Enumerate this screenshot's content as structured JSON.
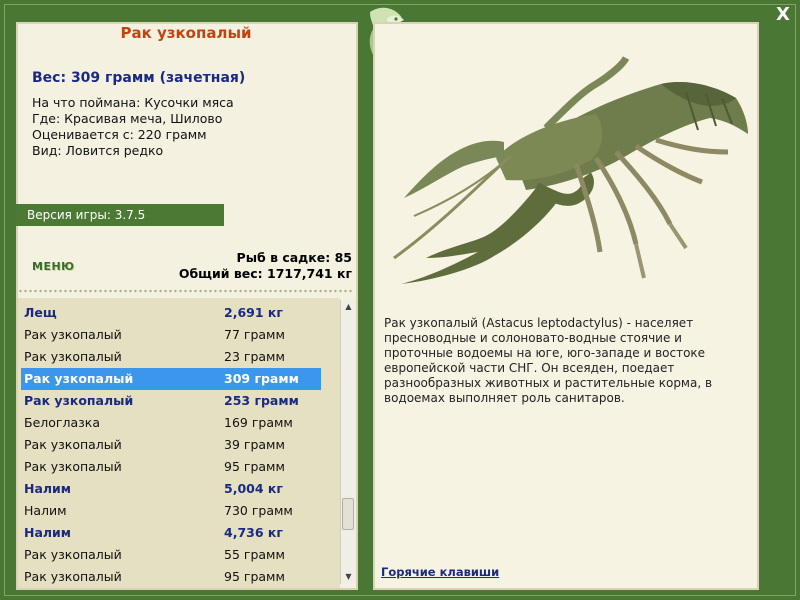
{
  "window": {
    "close_label": "X"
  },
  "fish": {
    "title": "Рак узкопалый",
    "weight": "Вес: 309 грамм (зачетная)",
    "caught_on": "На что поймана: Кусочки мяса",
    "location": "Где: Красивая меча, Шилово",
    "evaluated_from": "Оценивается с: 220 грамм",
    "kind": "Вид: Ловится редко"
  },
  "version": "Версия игры: 3.7.5",
  "menu_label": "МЕНЮ",
  "cage": {
    "count": "Рыб в садке: 85",
    "total_weight": "Общий вес: 1717,741 кг"
  },
  "catch_list": [
    {
      "name": "Лещ",
      "weight": "2,691 кг",
      "style": "bold"
    },
    {
      "name": "Рак узкопалый",
      "weight": "77 грамм",
      "style": "normal"
    },
    {
      "name": "Рак узкопалый",
      "weight": "23 грамм",
      "style": "normal"
    },
    {
      "name": "Рак узкопалый",
      "weight": "309 грамм",
      "style": "sel"
    },
    {
      "name": "Рак узкопалый",
      "weight": "253 грамм",
      "style": "bold"
    },
    {
      "name": "Белоглазка",
      "weight": "169 грамм",
      "style": "normal"
    },
    {
      "name": "Рак узкопалый",
      "weight": "39 грамм",
      "style": "normal"
    },
    {
      "name": "Рак узкопалый",
      "weight": "95 грамм",
      "style": "normal"
    },
    {
      "name": "Налим",
      "weight": "5,004 кг",
      "style": "bold"
    },
    {
      "name": "Налим",
      "weight": "730 грамм",
      "style": "normal"
    },
    {
      "name": "Налим",
      "weight": "4,736 кг",
      "style": "bold"
    },
    {
      "name": "Рак узкопалый",
      "weight": "55 грамм",
      "style": "normal"
    },
    {
      "name": "Рак узкопалый",
      "weight": "95 грамм",
      "style": "normal"
    }
  ],
  "scrollbar": {
    "up_icon": "arrow-up-icon",
    "down_icon": "arrow-down-icon",
    "position": 0.82
  },
  "description": "Рак узкопалый (Astacus leptodactylus) - населяет пресноводные и солоновато-водные стоячие и проточные водоемы на юге, юго-западе и востоке европейской части СНГ. Он всеяден, поедает разнообразных животных и растительные корма, в водоемах выполняет роль санитаров.",
  "hotkeys_label": "Горячие клавиши",
  "colors": {
    "frame": "#4a7733",
    "panel": "#f4f1e1",
    "selected": "#3c97ec",
    "title": "#c1440e",
    "accent_text": "#1a2a82"
  }
}
